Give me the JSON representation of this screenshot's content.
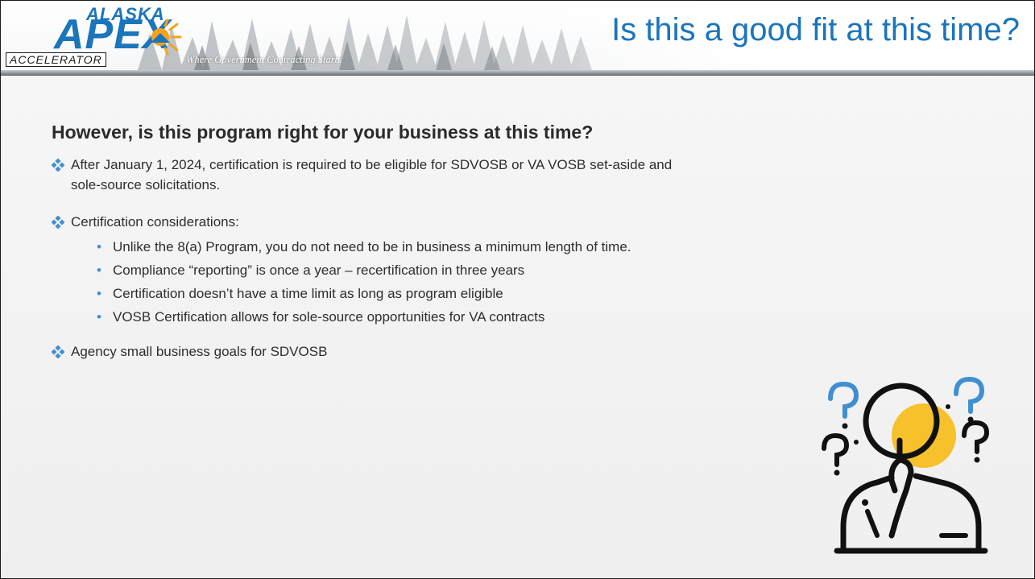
{
  "header": {
    "logo_alaska": "ALASKA",
    "logo_apex": "APEX",
    "logo_accelerator": "ACCELERATOR",
    "tagline": "Where Government Contracting Starts",
    "title": "Is this a good fit at this time?"
  },
  "content": {
    "heading": "However, is this program right for your business at this time?",
    "bullets": [
      {
        "text": "After January 1, 2024, certification is required to be eligible for SDVOSB or VA VOSB set-aside and sole-source solicitations."
      },
      {
        "text": "Certification considerations:",
        "sub": [
          "Unlike the 8(a) Program, you do not need to be in business a minimum length of time.",
          "Compliance “reporting” is once a year – recertification in three years",
          "Certification doesn’t have a time limit as long as program eligible",
          "VOSB Certification allows for sole-source opportunities for VA contracts"
        ]
      },
      {
        "text": "Agency small business goals for SDVOSB"
      }
    ]
  },
  "icons": {
    "bullet": "diamond-bullet-icon",
    "illustration": "thinking-person-magnifier-icon"
  },
  "colors": {
    "brand_blue": "#1b75bb",
    "bullet_blue": "#3f8fd1",
    "accent_yellow": "#f6c12b"
  }
}
